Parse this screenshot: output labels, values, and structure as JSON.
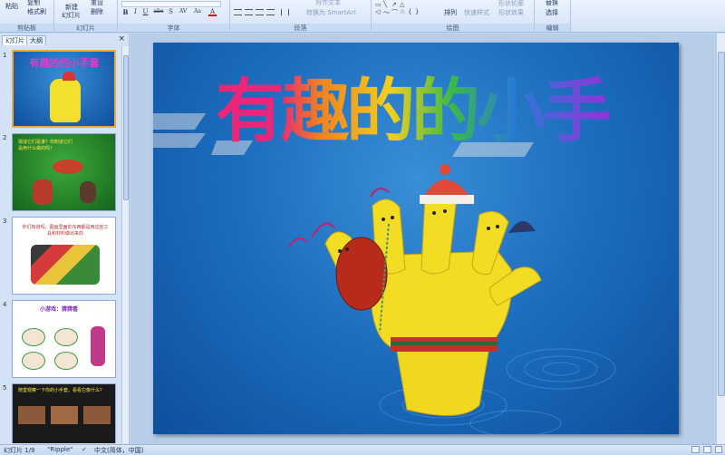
{
  "ribbon": {
    "clipboard": {
      "paste": "粘贴",
      "copy": "复制",
      "format_painter": "格式刷",
      "label": "剪贴板"
    },
    "slides": {
      "new_slide": "新建",
      "new_slide_2": "幻灯片",
      "reset": "重设",
      "delete": "删除",
      "label": "幻灯片"
    },
    "font": {
      "bold": "B",
      "italic": "I",
      "underline": "U",
      "strike": "abe",
      "shadow": "S",
      "spacing": "AV",
      "case": "Aa",
      "color": "A",
      "label": "字体"
    },
    "paragraph": {
      "text_direction": "对齐文本",
      "smartart": "转换为 SmartArt",
      "label": "段落"
    },
    "drawing": {
      "arrange": "排列",
      "quick_styles": "快速样式",
      "shape_fill": "形状轮廓",
      "shape_effects": "形状效果",
      "label": "绘图"
    },
    "editing": {
      "replace": "替换",
      "select": "选择",
      "label": "编辑"
    }
  },
  "left_panel": {
    "tabs": [
      "幻灯片",
      "大纲"
    ],
    "close": "×",
    "thumbnails": [
      {
        "num": "1",
        "text": "有趣的的小手套"
      },
      {
        "num": "2",
        "text": "猜谜它们是谁？你知道它们是用什么做的吗？"
      },
      {
        "num": "3",
        "text": "你们知道吗，图画里面的东西都是用这些工具和材料做出来的"
      },
      {
        "num": "4",
        "text": "小游戏：猜猜看"
      },
      {
        "num": "5",
        "text": "随堂观察一下你的小手套，看看它像什么？"
      }
    ]
  },
  "slide": {
    "title": "有趣的的小手套"
  },
  "status_bar": {
    "slide_info": "幻灯片 1/9",
    "theme": "\"Ripple\"",
    "language": "中文(简体，中国)"
  }
}
